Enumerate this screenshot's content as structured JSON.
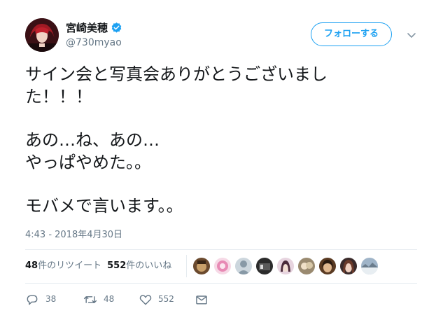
{
  "user": {
    "display_name": "宮崎美穂",
    "handle": "@730myao",
    "verified": true
  },
  "follow_button": {
    "label": "フォローする"
  },
  "tweet": {
    "lines_1": [
      "サイン会と写真会ありがとうございまし",
      "た！！！"
    ],
    "lines_2": [
      "あの…ね、あの…",
      "やっぱやめた。。"
    ],
    "lines_3": [
      "モバメで言います。。"
    ],
    "timestamp": "4:43 - 2018年4月30日"
  },
  "stats": {
    "retweets_count": "48",
    "retweets_label": "件のリツイート",
    "likes_count": "552",
    "likes_label": "件のいいね"
  },
  "liker_avatars": [
    "liker-avatar-1",
    "liker-avatar-2",
    "liker-avatar-3",
    "liker-avatar-4",
    "liker-avatar-5",
    "liker-avatar-6",
    "liker-avatar-7",
    "liker-avatar-8",
    "liker-avatar-9"
  ],
  "actions": {
    "reply_count": "38",
    "retweet_count": "48",
    "like_count": "552"
  },
  "colors": {
    "accent": "#1da1f2",
    "secondary_text": "#657786",
    "divider": "#e6ecf0"
  },
  "icons": {
    "verified": "verified-badge-icon",
    "caret": "chevron-down-icon",
    "reply": "reply-icon",
    "retweet": "retweet-icon",
    "like": "heart-icon",
    "dm": "envelope-icon"
  }
}
